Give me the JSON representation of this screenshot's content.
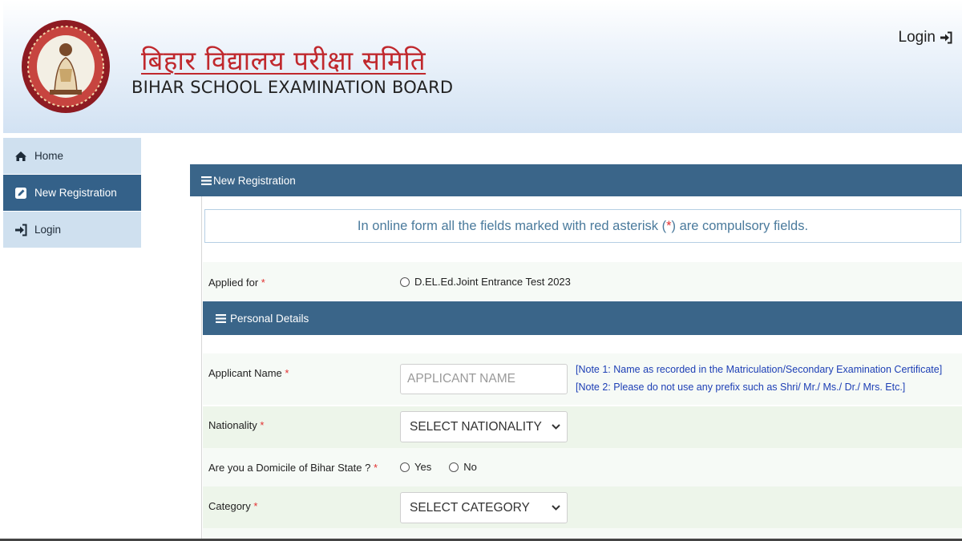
{
  "header": {
    "title_hindi": "बिहार विद्यालय परीक्षा समिति",
    "title_english": "BIHAR SCHOOL EXAMINATION BOARD",
    "login_label": "Login",
    "colors": {
      "header_gradient_bottom": "#d2e2f3",
      "hindi_title": "#c0282d"
    }
  },
  "sidebar": {
    "items": [
      {
        "label": "Home",
        "icon": "home-icon",
        "active": false
      },
      {
        "label": "New Registration",
        "icon": "edit-icon",
        "active": true
      },
      {
        "label": "Login",
        "icon": "sign-in-icon",
        "active": false
      }
    ],
    "colors": {
      "item_bg": "#cfe0ef",
      "active_bg": "#346189"
    }
  },
  "main": {
    "panel_title": "New Registration",
    "notice": {
      "before": "In online form all the fields marked with red asterisk (",
      "asterisk": "*",
      "after": ") are compulsory fields."
    },
    "applied_for": {
      "label": "Applied for",
      "required_mark": "*",
      "option": "D.EL.Ed.Joint Entrance Test 2023"
    },
    "personal_details": {
      "title": "Personal Details",
      "applicant_name": {
        "label": "Applicant Name",
        "required_mark": "*",
        "placeholder": "APPLICANT NAME",
        "value": "",
        "note1": "[Note 1: Name as recorded in the Matriculation/Secondary Examination Certificate]",
        "note2": "[Note 2: Please do not use any prefix such as Shri/ Mr./ Ms./ Dr./ Mrs. Etc.]"
      },
      "nationality": {
        "label": "Nationality",
        "required_mark": "*",
        "selected": "SELECT NATIONALITY"
      },
      "domicile": {
        "label": "Are you a Domicile of Bihar State ?",
        "required_mark": "*",
        "options": [
          "Yes",
          "No"
        ]
      },
      "category": {
        "label": "Category",
        "required_mark": "*",
        "selected": "SELECT CATEGORY"
      }
    },
    "colors": {
      "panel_header": "#3a6589",
      "note_text": "#1d3fb5",
      "required": "#e23131"
    }
  }
}
